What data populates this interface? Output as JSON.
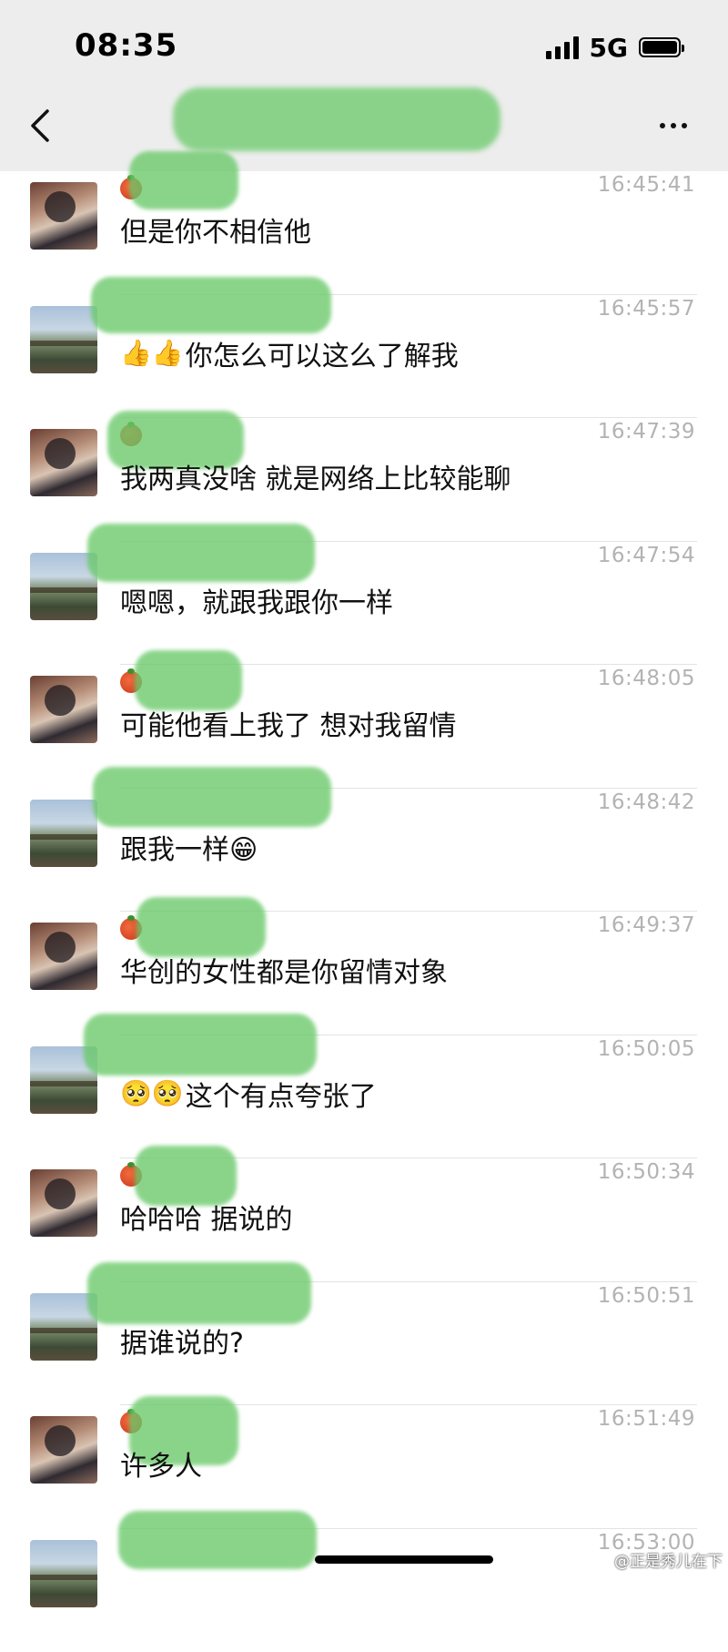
{
  "status_bar": {
    "time": "08:35",
    "network": "5G",
    "signal_bars": 4,
    "battery_level": 0.9
  },
  "nav": {
    "back_icon": "chevron-left-icon",
    "more_icon": "more-dots-icon"
  },
  "messages": [
    {
      "avatar": "a",
      "tomato": true,
      "time": "16:45:41",
      "prefix": "",
      "text": "但是你不相信他"
    },
    {
      "avatar": "b",
      "tomato": false,
      "time": "16:45:57",
      "prefix": "👍👍",
      "text": "你怎么可以这么了解我"
    },
    {
      "avatar": "a",
      "tomato": true,
      "time": "16:47:39",
      "prefix": "",
      "text": "我两真没啥 就是网络上比较能聊"
    },
    {
      "avatar": "b",
      "tomato": false,
      "time": "16:47:54",
      "prefix": "",
      "text": "嗯嗯，就跟我跟你一样"
    },
    {
      "avatar": "a",
      "tomato": true,
      "time": "16:48:05",
      "prefix": "",
      "text": "可能他看上我了 想对我留情"
    },
    {
      "avatar": "b",
      "tomato": false,
      "time": "16:48:42",
      "prefix": "",
      "text": "跟我一样😁"
    },
    {
      "avatar": "a",
      "tomato": true,
      "time": "16:49:37",
      "prefix": "",
      "text": "华创的女性都是你留情对象"
    },
    {
      "avatar": "b",
      "tomato": false,
      "time": "16:50:05",
      "prefix": "🥺🥺",
      "text": "这个有点夸张了"
    },
    {
      "avatar": "a",
      "tomato": true,
      "time": "16:50:34",
      "prefix": "",
      "text": "哈哈哈 据说的"
    },
    {
      "avatar": "b",
      "tomato": false,
      "time": "16:50:51",
      "prefix": "",
      "text": "据谁说的?"
    },
    {
      "avatar": "a",
      "tomato": true,
      "time": "16:51:49",
      "prefix": "",
      "text": "许多人"
    },
    {
      "avatar": "b",
      "tomato": false,
      "time": "16:53:00",
      "prefix": "",
      "text": ""
    }
  ],
  "watermark": "@正是秀儿在下",
  "colors": {
    "redaction": "#6ac96a",
    "header_bg": "#ededed",
    "timestamp": "#b3b3b3"
  }
}
